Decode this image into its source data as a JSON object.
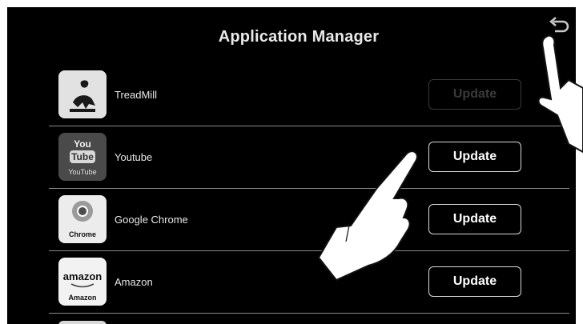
{
  "header": {
    "title": "Application Manager",
    "back_icon": "back-arrow-icon"
  },
  "apps": [
    {
      "name": "TreadMill",
      "update_label": "Update",
      "update_enabled": false,
      "icon": "treadmill-app-icon",
      "icon_caption": ""
    },
    {
      "name": "Youtube",
      "update_label": "Update",
      "update_enabled": true,
      "icon": "youtube-app-icon",
      "icon_top": "You",
      "icon_mid": "Tube",
      "icon_caption": "YouTube"
    },
    {
      "name": "Google Chrome",
      "update_label": "Update",
      "update_enabled": true,
      "icon": "chrome-app-icon",
      "icon_caption": "Chrome"
    },
    {
      "name": "Amazon",
      "update_label": "Update",
      "update_enabled": true,
      "icon": "amazon-app-icon",
      "icon_logo": "amazon",
      "icon_caption": "Amazon"
    }
  ],
  "colors": {
    "background": "#000000",
    "text": "#e8e8e8",
    "button_border": "#d9d9d9",
    "disabled": "#3a3a3a",
    "divider": "#8a8a8a"
  }
}
